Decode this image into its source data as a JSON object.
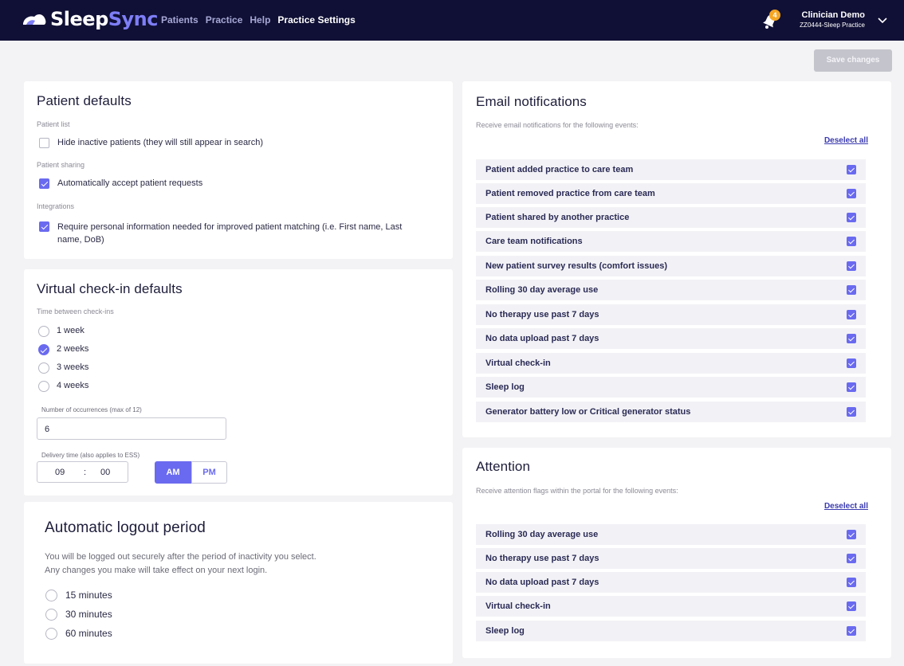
{
  "header": {
    "brand_sleep": "Sleep",
    "brand_sync": "Sync",
    "nav": [
      "Patients",
      "Practice",
      "Help",
      "Practice Settings"
    ],
    "notification_count": "4",
    "user_name": "Clinician Demo",
    "user_practice": "ZZ0444-Sleep Practice",
    "icons": [
      "logo-mark",
      "bell-icon",
      "chevron-down-icon"
    ]
  },
  "save_label": "Save changes",
  "patient_defaults": {
    "title": "Patient defaults",
    "list_label": "Patient list",
    "hide_inactive": "Hide inactive patients (they will still appear in search)",
    "hide_inactive_checked": false,
    "sharing_label": "Patient sharing",
    "auto_accept": "Automatically accept patient requests",
    "auto_accept_checked": true,
    "integrations_label": "Integrations",
    "require_personal": "Require personal information needed for improved patient matching (i.e. First name, Last name, DoB)",
    "require_personal_checked": true
  },
  "virtual_checkin": {
    "title": "Virtual check-in defaults",
    "time_label": "Time between check-ins",
    "options": [
      "1 week",
      "2 weeks",
      "3 weeks",
      "4 weeks"
    ],
    "selected": "2 weeks",
    "occurrences_label": "Number of occurrences (max of 12)",
    "occurrences_value": "6",
    "delivery_label": "Delivery time (also applies to ESS)",
    "hour": "09",
    "separator": ":",
    "minute": "00",
    "am": "AM",
    "pm": "PM",
    "am_pm_selected": "AM"
  },
  "auto_logout": {
    "title": "Automatic logout period",
    "desc1": "You will be logged out securely after the period of inactivity you select.",
    "desc2": "Any changes you make will take effect on your next login.",
    "options": [
      "15 minutes",
      "30 minutes",
      "60 minutes"
    ],
    "selected": null
  },
  "email_notifications": {
    "title": "Email notifications",
    "subtitle": "Receive email notifications for the following events:",
    "deselect": "Deselect all",
    "items": [
      "Patient added practice to care team",
      "Patient removed practice from care team",
      "Patient shared by another practice",
      "Care team notifications",
      "New patient survey results (comfort issues)",
      "Rolling 30 day average use",
      "No therapy use past 7 days",
      "No data upload past 7 days",
      "Virtual check-in",
      "Sleep log",
      "Generator battery low or Critical generator status"
    ],
    "all_checked": true
  },
  "attention": {
    "title": "Attention",
    "subtitle": "Receive attention flags within the portal for the following events:",
    "deselect": "Deselect all",
    "items": [
      "Rolling 30 day average use",
      "No therapy use past 7 days",
      "No data upload past 7 days",
      "Virtual check-in",
      "Sleep log"
    ],
    "all_checked": true
  },
  "colors": {
    "topbar": "#101036",
    "accent": "#6a6af0",
    "nav_inactive": "#a7a8d6",
    "badge": "#f5a623"
  }
}
